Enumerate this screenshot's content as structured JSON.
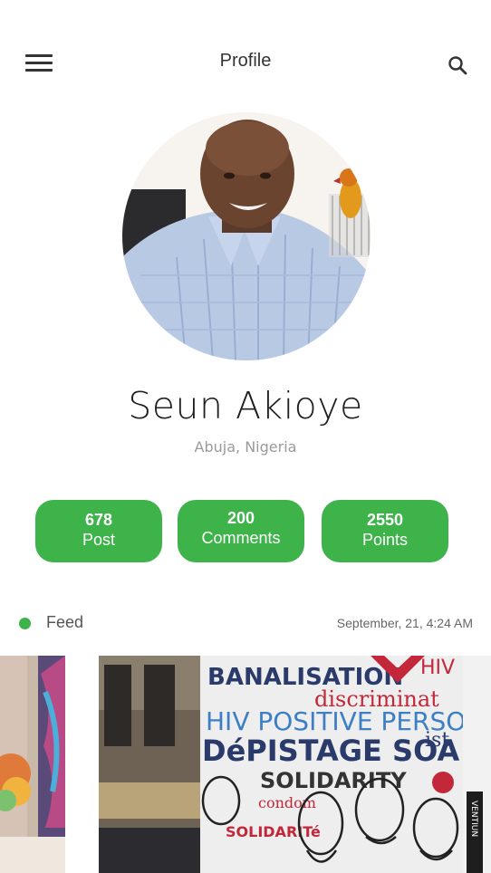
{
  "header": {
    "title": "Profile",
    "menu_icon": "hamburger-menu-icon",
    "search_icon": "search-icon"
  },
  "profile": {
    "name": "Seun Akioye",
    "location": "Abuja, Nigeria"
  },
  "stats": [
    {
      "value": "678",
      "label": "Post"
    },
    {
      "value": "200",
      "label": "Comments"
    },
    {
      "value": "2550",
      "label": "Points"
    }
  ],
  "feed": {
    "label": "Feed",
    "date": "September, 21,  4:24 AM",
    "mural_text": {
      "line1": "BANALISATION",
      "line2": "discriminat",
      "line3": "HIV POSITIVE PERSON",
      "line4": "DéPISTAGE SOA",
      "line5": "SOLIDARITY",
      "line6": "condom",
      "line7": "SOLIDARITé",
      "hiv": "HIV",
      "ist": "ist",
      "sign": "VENTIUN"
    }
  },
  "colors": {
    "accent": "#3db34a",
    "text_primary": "#1f1f1f",
    "text_secondary": "#9a9a9a"
  }
}
